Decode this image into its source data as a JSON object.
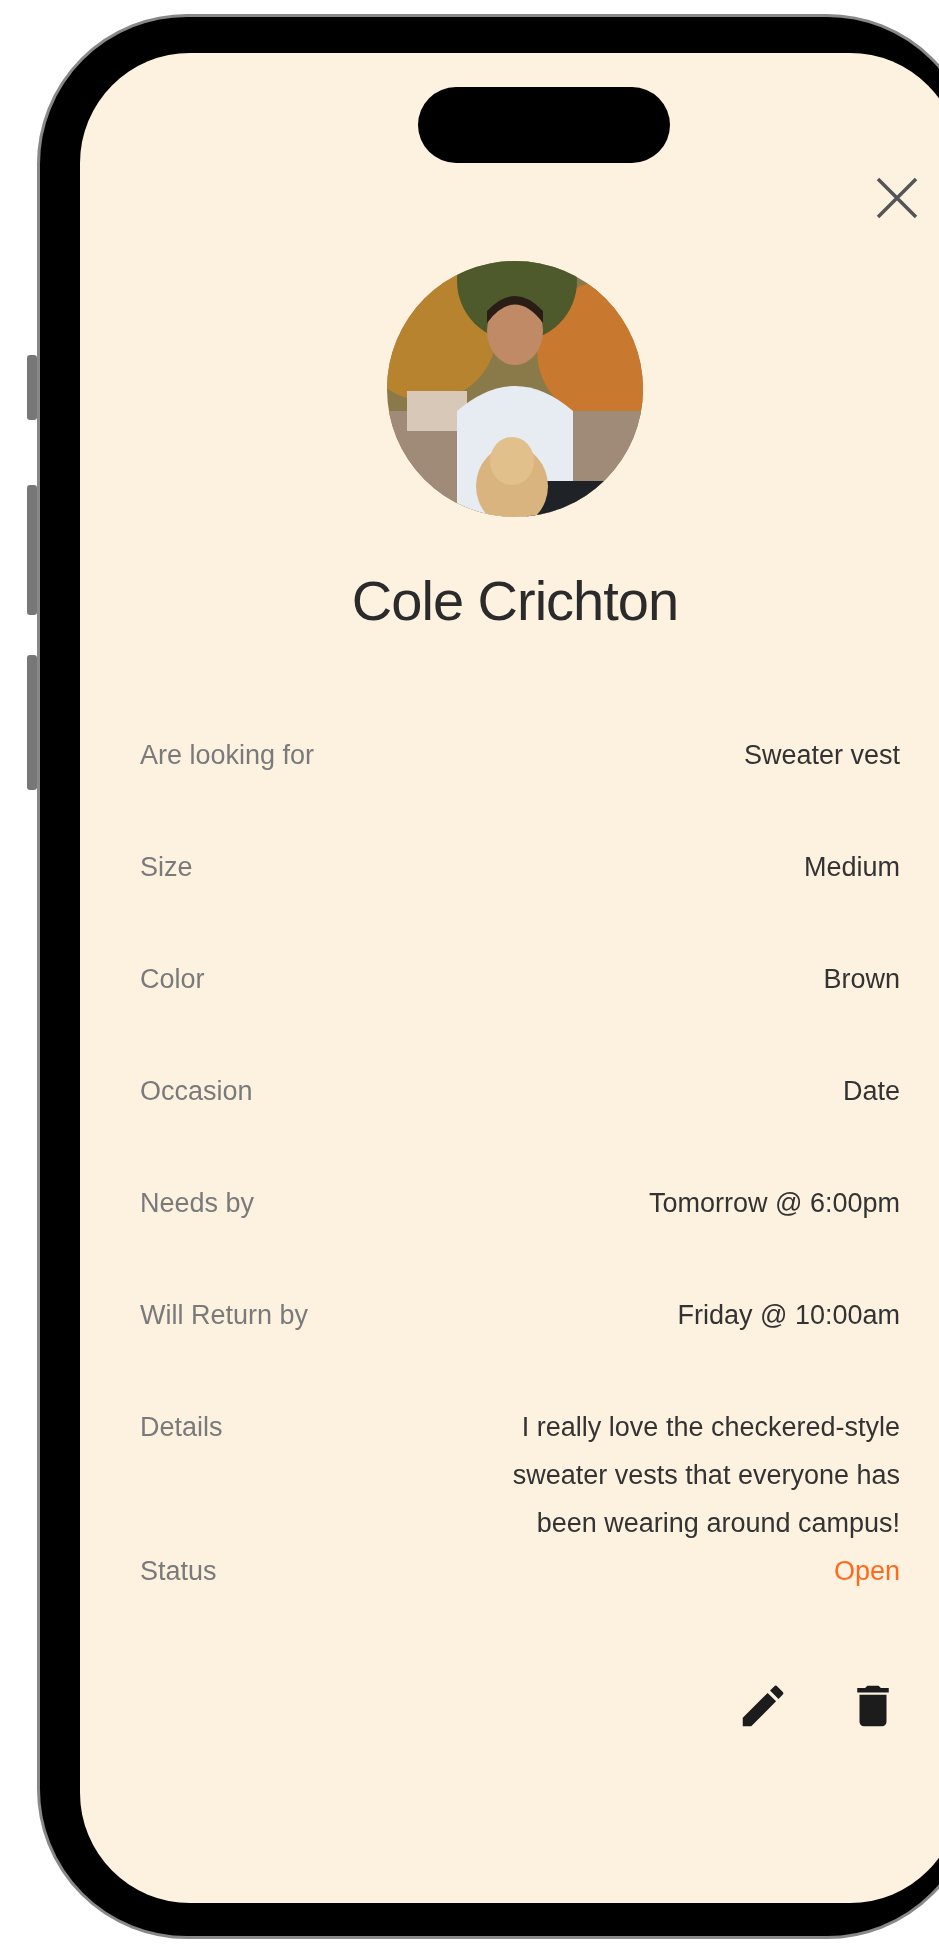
{
  "profile": {
    "name": "Cole Crichton"
  },
  "fields": [
    {
      "label": "Are looking for",
      "value": "Sweater vest",
      "kind": "text"
    },
    {
      "label": "Size",
      "value": "Medium",
      "kind": "text"
    },
    {
      "label": "Color",
      "value": "Brown",
      "kind": "text"
    },
    {
      "label": "Occasion",
      "value": "Date",
      "kind": "text"
    },
    {
      "label": "Needs by",
      "value": "Tomorrow @ 6:00pm",
      "kind": "text"
    },
    {
      "label": "Will Return by",
      "value": "Friday @ 10:00am",
      "kind": "text"
    },
    {
      "label": "Details",
      "value": "I really love the checkered-style sweater vests that everyone has been wearing around campus!",
      "kind": "text"
    },
    {
      "label": "Status",
      "value": "Open",
      "kind": "status"
    }
  ]
}
